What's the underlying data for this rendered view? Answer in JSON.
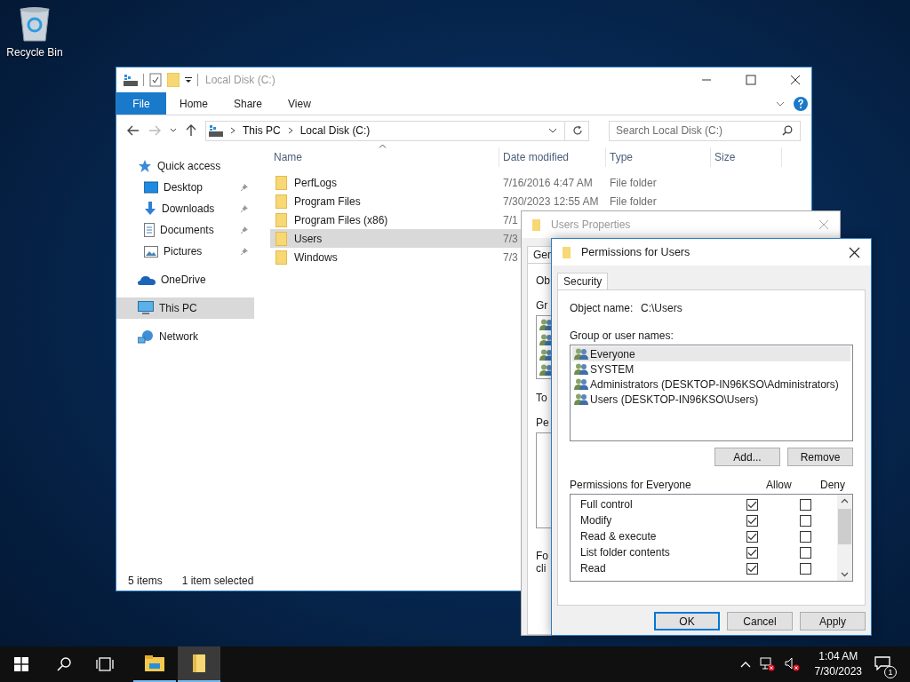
{
  "desktop": {
    "icons": [
      {
        "label": "Recycle Bin"
      }
    ]
  },
  "explorer": {
    "title": "Local Disk (C:)",
    "ribbon_tabs": [
      {
        "label": "File",
        "kind": "menu"
      },
      {
        "label": "Home",
        "kind": "tab"
      },
      {
        "label": "Share",
        "kind": "tab"
      },
      {
        "label": "View",
        "kind": "tab"
      }
    ],
    "breadcrumb": [
      "This PC",
      "Local Disk (C:)"
    ],
    "search": {
      "placeholder": "Search Local Disk (C:)"
    },
    "nav": [
      {
        "label": "Quick access",
        "kind": "star",
        "selected": false,
        "children": [
          {
            "label": "Desktop",
            "kind": "desktop",
            "pinned": true,
            "selected": false
          },
          {
            "label": "Downloads",
            "kind": "download",
            "pinned": true,
            "selected": false
          },
          {
            "label": "Documents",
            "kind": "document",
            "pinned": true,
            "selected": false
          },
          {
            "label": "Pictures",
            "kind": "picture",
            "pinned": true,
            "selected": false
          }
        ]
      },
      {
        "label": "OneDrive",
        "kind": "cloud",
        "selected": false
      },
      {
        "label": "This PC",
        "kind": "pc",
        "selected": true
      },
      {
        "label": "Network",
        "kind": "network",
        "selected": false
      }
    ],
    "columns": [
      "Name",
      "Date modified",
      "Type",
      "Size"
    ],
    "rows": [
      {
        "name": "PerfLogs",
        "date": "7/16/2016 4:47 AM",
        "type": "File folder",
        "selected": false
      },
      {
        "name": "Program Files",
        "date": "7/30/2023 12:55 AM",
        "type": "File folder",
        "selected": false
      },
      {
        "name": "Program Files (x86)",
        "date": "7/1",
        "selected": false
      },
      {
        "name": "Users",
        "date": "7/3",
        "selected": true
      },
      {
        "name": "Windows",
        "date": "7/3",
        "selected": false
      }
    ],
    "status": {
      "count": "5 items",
      "selection": "1 item selected"
    }
  },
  "properties": {
    "title": "Users Properties",
    "tab": "Gen",
    "items": [
      {
        "kind": "label",
        "text": "Ob"
      },
      {
        "kind": "label",
        "text": "Gr"
      },
      {
        "kind": "userlist"
      },
      {
        "kind": "label",
        "text": "To"
      },
      {
        "kind": "label",
        "text": "Pe"
      },
      {
        "kind": "box"
      },
      {
        "kind": "label",
        "text": "Fo"
      },
      {
        "kind": "line",
        "text": "cli"
      }
    ]
  },
  "permissions": {
    "title": "Permissions for Users",
    "tabs": [
      {
        "label": "Security",
        "selected": true
      }
    ],
    "object_label": "Object name:",
    "object_value": "C:\\Users",
    "group_label": "Group or user names:",
    "users": [
      {
        "name": "Everyone",
        "selected": true
      },
      {
        "name": "SYSTEM",
        "selected": false
      },
      {
        "name": "Administrators (DESKTOP-IN96KSO\\Administrators)",
        "selected": false
      },
      {
        "name": "Users (DESKTOP-IN96KSO\\Users)",
        "selected": false
      }
    ],
    "user_buttons": [
      "Add...",
      "Remove"
    ],
    "perm_heading": "Permissions for Everyone",
    "allow_label": "Allow",
    "deny_label": "Deny",
    "entries": [
      {
        "name": "Full control",
        "allow": true,
        "deny": false
      },
      {
        "name": "Modify",
        "allow": true,
        "deny": false
      },
      {
        "name": "Read & execute",
        "allow": true,
        "deny": false
      },
      {
        "name": "List folder contents",
        "allow": true,
        "deny": false
      },
      {
        "name": "Read",
        "allow": true,
        "deny": false
      }
    ],
    "buttons": [
      {
        "label": "OK",
        "kind": "default"
      },
      {
        "label": "Cancel",
        "kind": "normal"
      },
      {
        "label": "Apply",
        "kind": "normal"
      }
    ]
  },
  "taskbar": {
    "apps": [
      {
        "kind": "explorer",
        "selected": false
      },
      {
        "kind": "folder",
        "selected": true
      }
    ],
    "time": "1:04 AM",
    "date": "7/30/2023",
    "notifications": "1"
  }
}
